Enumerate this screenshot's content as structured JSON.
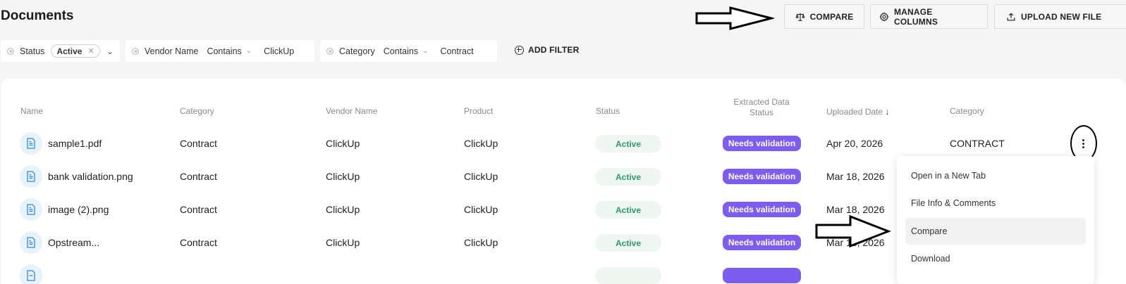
{
  "page": {
    "title": "Documents"
  },
  "toolbar": {
    "compare_label": "COMPARE",
    "manage_columns_label": "MANAGE COLUMNS",
    "upload_label": "UPLOAD NEW FILE"
  },
  "filters": [
    {
      "field": "Status",
      "chip": "Active"
    },
    {
      "field": "Vendor Name",
      "operator": "Contains",
      "value": "ClickUp"
    },
    {
      "field": "Category",
      "operator": "Contains",
      "value": "Contract"
    }
  ],
  "add_filter_label": "ADD FILTER",
  "table": {
    "headers": {
      "name": "Name",
      "category": "Category",
      "vendor": "Vendor Name",
      "product": "Product",
      "status": "Status",
      "extracted_line1": "Extracted Data",
      "extracted_line2": "Status",
      "uploaded": "Uploaded Date",
      "category2": "Category"
    },
    "rows": [
      {
        "name": "sample1.pdf",
        "category": "Contract",
        "vendor": "ClickUp",
        "product": "ClickUp",
        "status": "Active",
        "extracted": "Needs validation",
        "uploaded": "Apr 20, 2026",
        "category2": "CONTRACT"
      },
      {
        "name": "bank validation.png",
        "category": "Contract",
        "vendor": "ClickUp",
        "product": "ClickUp",
        "status": "Active",
        "extracted": "Needs validation",
        "uploaded": "Mar 18, 2026",
        "category2": ""
      },
      {
        "name": "image (2).png",
        "category": "Contract",
        "vendor": "ClickUp",
        "product": "ClickUp",
        "status": "Active",
        "extracted": "Needs validation",
        "uploaded": "Mar 18, 2026",
        "category2": ""
      },
      {
        "name": "Opstream...",
        "category": "Contract",
        "vendor": "ClickUp",
        "product": "ClickUp",
        "status": "Active",
        "extracted": "Needs validation",
        "uploaded": "Mar 18, 2026",
        "category2": ""
      }
    ]
  },
  "context_menu": {
    "items": [
      "Open in a New Tab",
      "File Info & Comments",
      "Compare",
      "Download"
    ],
    "highlighted": "Compare"
  },
  "colors": {
    "accent_purple": "#7d5cf0",
    "status_green": "#2f9a6a",
    "file_icon_blue": "#2f8ad6"
  },
  "icons": [
    "balance-scale-icon",
    "gear-icon",
    "upload-icon",
    "file-icon",
    "plus-circle-icon",
    "clear-filter-icon",
    "sort-down-icon",
    "kebab-menu-icon"
  ]
}
